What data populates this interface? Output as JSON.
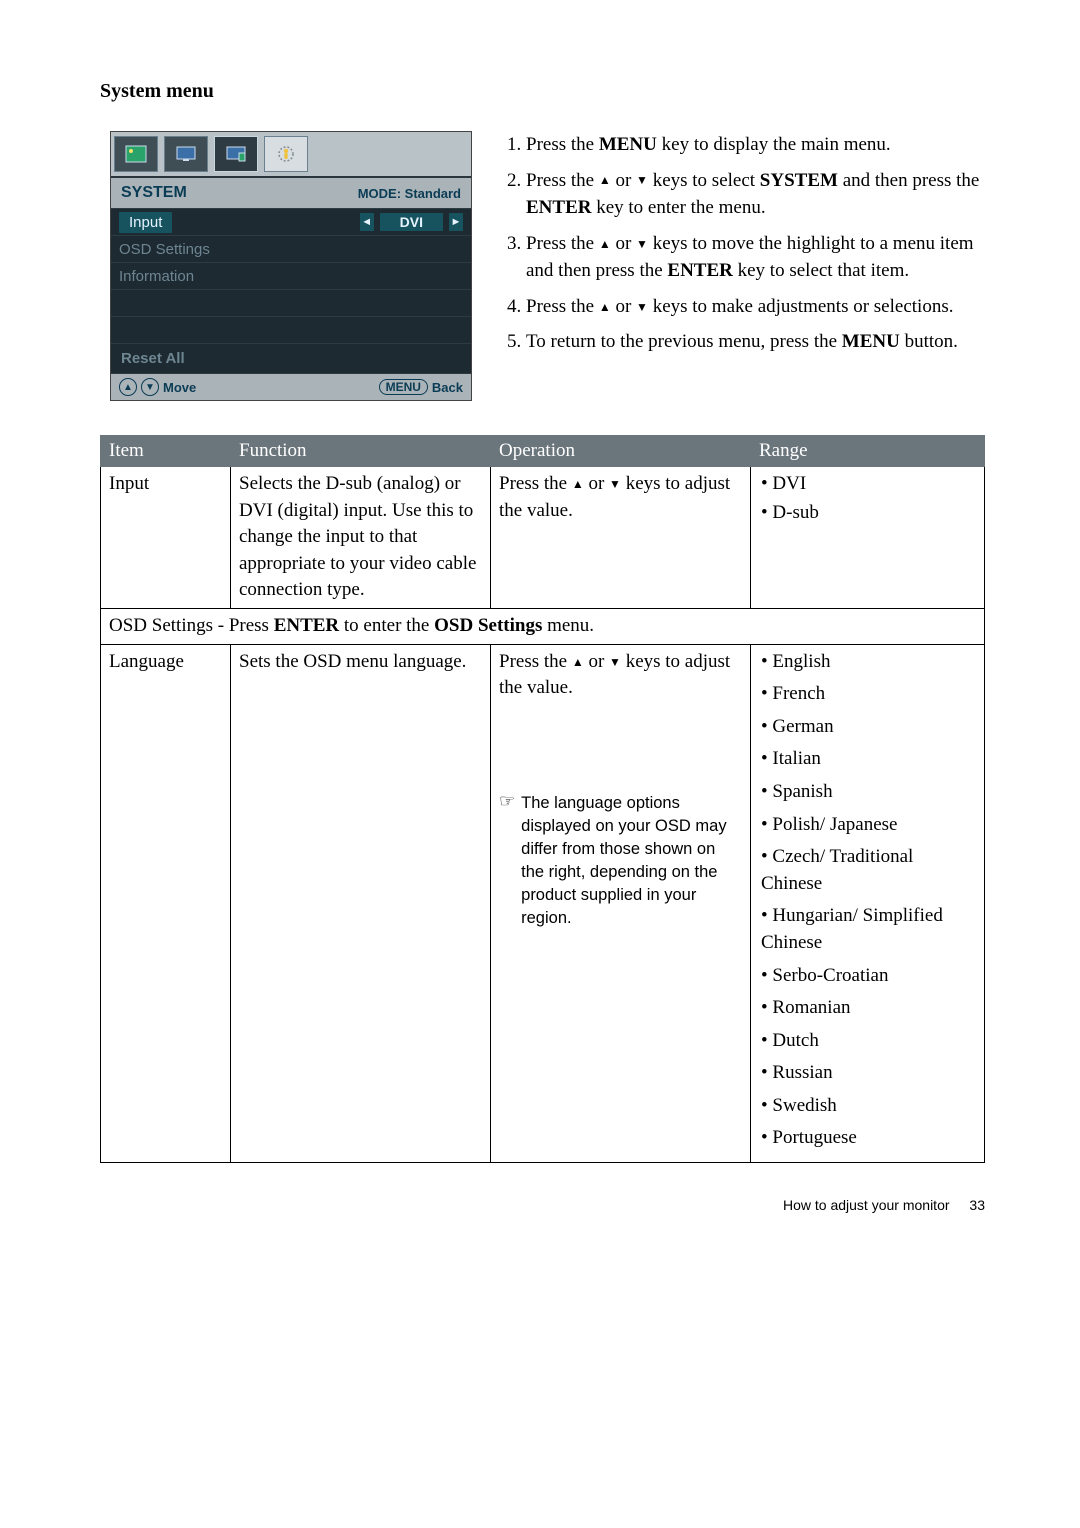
{
  "section_title": "System menu",
  "osd": {
    "header_title": "SYSTEM",
    "mode_label": "MODE: Standard",
    "items": [
      {
        "label": "Input",
        "value": "DVI",
        "active": true
      },
      {
        "label": "OSD Settings"
      },
      {
        "label": "Information"
      }
    ],
    "reset_label": "Reset All",
    "footer_move": "Move",
    "footer_menu": "MENU",
    "footer_back": "Back"
  },
  "instructions": {
    "i1_a": "Press the ",
    "i1_b": "MENU",
    "i1_c": " key to display the main menu.",
    "i2_a": "Press the ",
    "i2_b": " or ",
    "i2_c": " keys to select ",
    "i2_d": "SYSTEM",
    "i2_e": " and then press the ",
    "i2_f": "ENTER",
    "i2_g": " key to enter the menu.",
    "i3_a": "Press the ",
    "i3_b": " or ",
    "i3_c": " keys to move the highlight to a menu item and then press the ",
    "i3_d": "ENTER",
    "i3_e": " key to select that item.",
    "i4_a": "Press the ",
    "i4_b": " or ",
    "i4_c": " keys to make adjustments or selections.",
    "i5_a": "To return to the previous menu, press the ",
    "i5_b": "MENU",
    "i5_c": " button."
  },
  "table": {
    "headers": {
      "item": "Item",
      "function": "Function",
      "operation": "Operation",
      "range": "Range"
    },
    "row_input": {
      "item": "Input",
      "function": "Selects the D-sub (analog) or DVI (digital) input. Use this to change the input to that appropriate to your video cable connection type.",
      "op_a": "Press the ",
      "op_b": " or ",
      "op_c": " keys to adjust the value.",
      "range": [
        "• DVI",
        "• D-sub"
      ]
    },
    "row_osd_note_a": "OSD Settings - Press ",
    "row_osd_note_b": "ENTER",
    "row_osd_note_c": " to enter the ",
    "row_osd_note_d": "OSD Settings",
    "row_osd_note_e": " menu.",
    "row_lang": {
      "item": "Language",
      "function": "Sets the OSD menu language.",
      "op_a": "Press the ",
      "op_b": " or ",
      "op_c": " keys to adjust the value.",
      "note": "The language options displayed on your OSD may differ from those shown on the right, depending on the product supplied in your region.",
      "range": [
        "• English",
        "• French",
        "• German",
        "• Italian",
        "• Spanish",
        "• Polish/ Japanese",
        "• Czech/ Traditional Chinese",
        "• Hungarian/ Simplified Chinese",
        "• Serbo-Croatian",
        "• Romanian",
        "• Dutch",
        "• Russian",
        "• Swedish",
        "• Portuguese"
      ]
    }
  },
  "footer": {
    "text": "How to adjust your monitor",
    "page": "33"
  }
}
